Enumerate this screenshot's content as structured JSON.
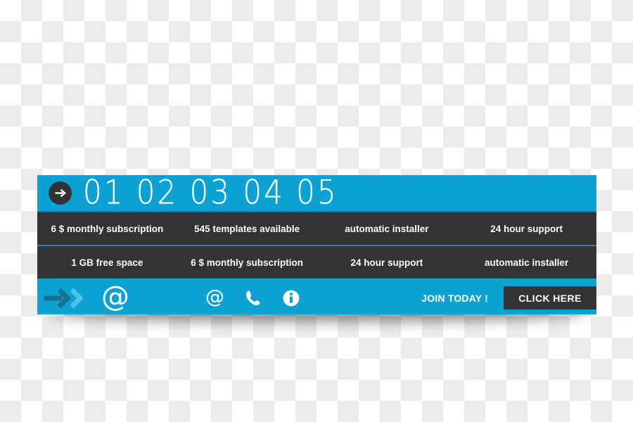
{
  "banner": {
    "header": {
      "arrow_icon": "arrow-right-circle-icon",
      "numbers": "01 02 03 04 05"
    },
    "feature_rows": [
      {
        "cells": [
          "6 $ monthly subscription",
          "545 templates available",
          "automatic installer",
          "24 hour support"
        ]
      },
      {
        "cells": [
          "1 GB free space",
          "6 $ monthly subscription",
          "24 hour support",
          "automatic installer"
        ]
      }
    ],
    "footer": {
      "chevron_icon": "double-chevron-right-icon",
      "brand_at_icon": "at-sign-icon",
      "contacts": [
        {
          "icon": "at-sign-icon",
          "glyph": "@"
        },
        {
          "icon": "phone-icon",
          "glyph": ""
        },
        {
          "icon": "info-circle-icon",
          "glyph": ""
        }
      ],
      "join_label": "JOIN TODAY !",
      "cta_label": "CLICK HERE"
    }
  },
  "colors": {
    "accent_blue": "#0ba2d3",
    "dark_bar": "#333333",
    "divider_blue": "#2f7fc4",
    "text_white": "#ffffff"
  }
}
